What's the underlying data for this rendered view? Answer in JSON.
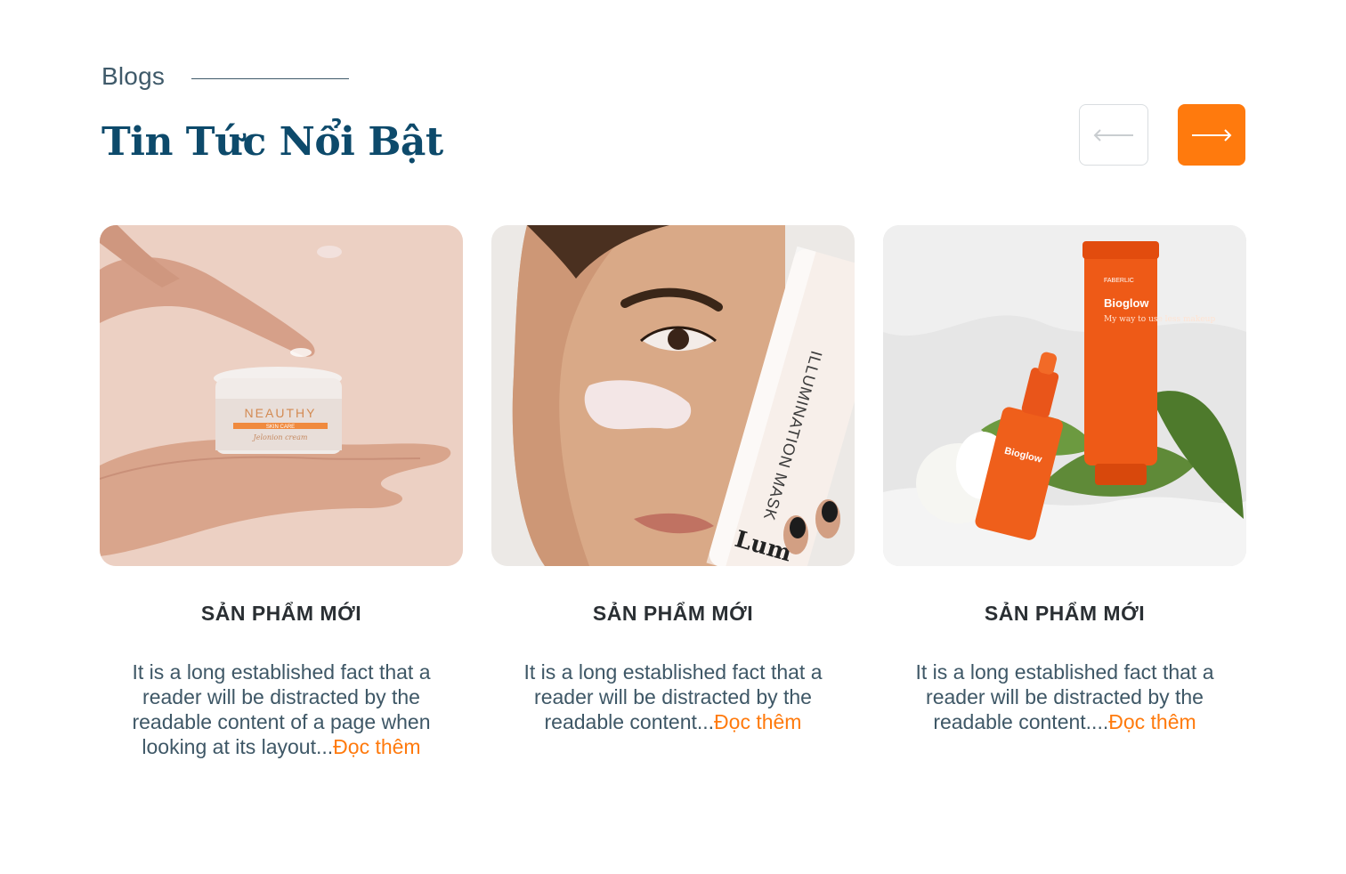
{
  "section": {
    "eyebrow": "Blogs",
    "title": "Tin Tức Nổi Bật"
  },
  "nav": {
    "prev_icon": "arrow-left-icon",
    "next_icon": "arrow-right-icon",
    "accent_color": "#ff7a0d"
  },
  "colors": {
    "title": "#0d4a6b",
    "text": "#3e5766",
    "accent": "#ff7a0d"
  },
  "cards": [
    {
      "image_label": "NEAUTHY",
      "image_sublabel": "SKIN CARE",
      "image_script": "Jelonion cream",
      "category": "SẢN PHẨM MỚI",
      "excerpt": "It is a long established fact that a reader will be distracted by the readable content of a page when looking at its layout...",
      "read_more": "Đọc thêm"
    },
    {
      "image_label": "ILLUMINATION MASK",
      "image_sublabel": "Lum",
      "category": "SẢN PHẨM MỚI",
      "excerpt": "It is a long established fact that a reader will be distracted by the readable content...",
      "read_more": "Đọc thêm"
    },
    {
      "image_label": "Bioglow",
      "image_sublabel": "FABERLIC",
      "image_script": "My way to use less makeup",
      "category": "SẢN PHẨM MỚI",
      "excerpt": "It is a long established fact that a reader will be distracted by the readable content....",
      "read_more": "Đọc thêm"
    }
  ]
}
